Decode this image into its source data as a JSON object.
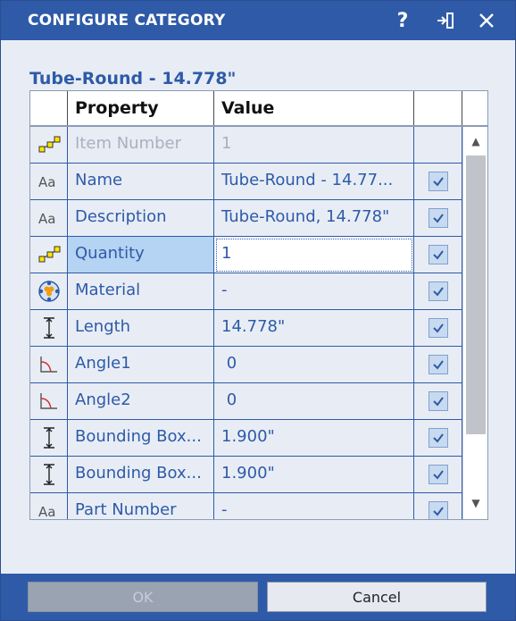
{
  "dialog": {
    "title": "CONFIGURE CATEGORY",
    "help_label": "?",
    "subtitle": "Tube-Round - 14.778\""
  },
  "grid": {
    "headers": {
      "property": "Property",
      "value": "Value"
    },
    "rows": [
      {
        "icon": "numeric-icon",
        "property": "Item Number",
        "value": "1",
        "checked": false,
        "disabled": true
      },
      {
        "icon": "text-icon",
        "property": "Name",
        "value": "Tube-Round - 14.77...",
        "checked": true
      },
      {
        "icon": "text-icon",
        "property": "Description",
        "value": "Tube-Round, 14.778\"",
        "checked": true
      },
      {
        "icon": "numeric-icon",
        "property": "Quantity",
        "value": "1",
        "checked": true,
        "selected": true
      },
      {
        "icon": "material-icon",
        "property": "Material",
        "value": "-",
        "checked": true
      },
      {
        "icon": "length-icon",
        "property": "Length",
        "value": "14.778\"",
        "checked": true
      },
      {
        "icon": "angle-icon",
        "property": "Angle1",
        "value": " 0",
        "checked": true
      },
      {
        "icon": "angle-icon",
        "property": "Angle2",
        "value": " 0",
        "checked": true
      },
      {
        "icon": "length-icon",
        "property": "Bounding Box...",
        "value": "1.900\"",
        "checked": true
      },
      {
        "icon": "length-icon",
        "property": "Bounding Box...",
        "value": "1.900\"",
        "checked": true
      },
      {
        "icon": "text-icon",
        "property": "Part Number",
        "value": "-",
        "checked": true
      }
    ]
  },
  "buttons": {
    "ok": "OK",
    "cancel": "Cancel"
  }
}
